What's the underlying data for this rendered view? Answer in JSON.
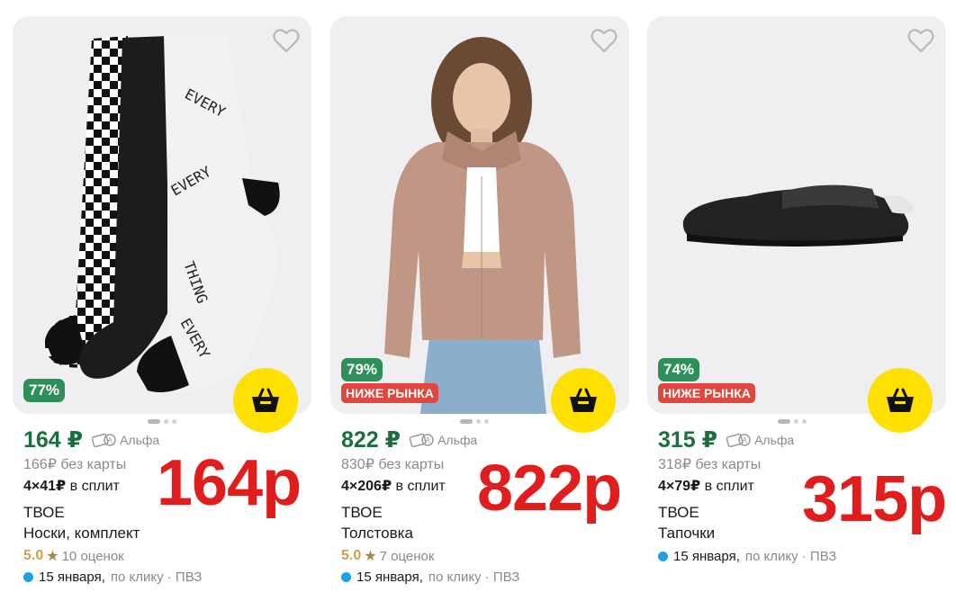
{
  "currency": "₽",
  "alfa_label": "Альфа",
  "colors": {
    "price_green": "#1b6f3c",
    "discount_green": "#2f8f5a",
    "market_red": "#e0473e",
    "cart_yellow": "#ffe000",
    "overlay_red": "#e01e1e",
    "delivery_blue": "#1aa3e8"
  },
  "products": [
    {
      "price": "164 ₽",
      "no_card": "166₽ без карты",
      "split_amount": "4×41₽",
      "split_label": "в сплит",
      "brand": "ТВОЕ",
      "title": "Носки, комплект",
      "rating": "5.0",
      "reviews": "10 оценок",
      "discount": "77%",
      "market_badge": "",
      "delivery_date": "15 января,",
      "delivery_rest": "по клику · ПВЗ",
      "overlay": "164р",
      "icons": [
        "heart-icon",
        "cart-basket-icon",
        "alfa-card-icon"
      ]
    },
    {
      "price": "822 ₽",
      "no_card": "830₽ без карты",
      "split_amount": "4×206₽",
      "split_label": "в сплит",
      "brand": "ТВОЕ",
      "title": "Толстовка",
      "rating": "5.0",
      "reviews": "7 оценок",
      "discount": "79%",
      "market_badge": "НИЖЕ РЫНКА",
      "delivery_date": "15 января,",
      "delivery_rest": "по клику · ПВЗ",
      "overlay": "822р",
      "icons": [
        "heart-icon",
        "cart-basket-icon",
        "alfa-card-icon"
      ]
    },
    {
      "price": "315 ₽",
      "no_card": "318₽ без карты",
      "split_amount": "4×79₽",
      "split_label": "в сплит",
      "brand": "ТВОЕ",
      "title": "Тапочки",
      "rating": "",
      "reviews": "",
      "discount": "74%",
      "market_badge": "НИЖЕ РЫНКА",
      "delivery_date": "15 января,",
      "delivery_rest": "по клику · ПВЗ",
      "overlay": "315р",
      "icons": [
        "heart-icon",
        "cart-basket-icon",
        "alfa-card-icon"
      ]
    }
  ]
}
